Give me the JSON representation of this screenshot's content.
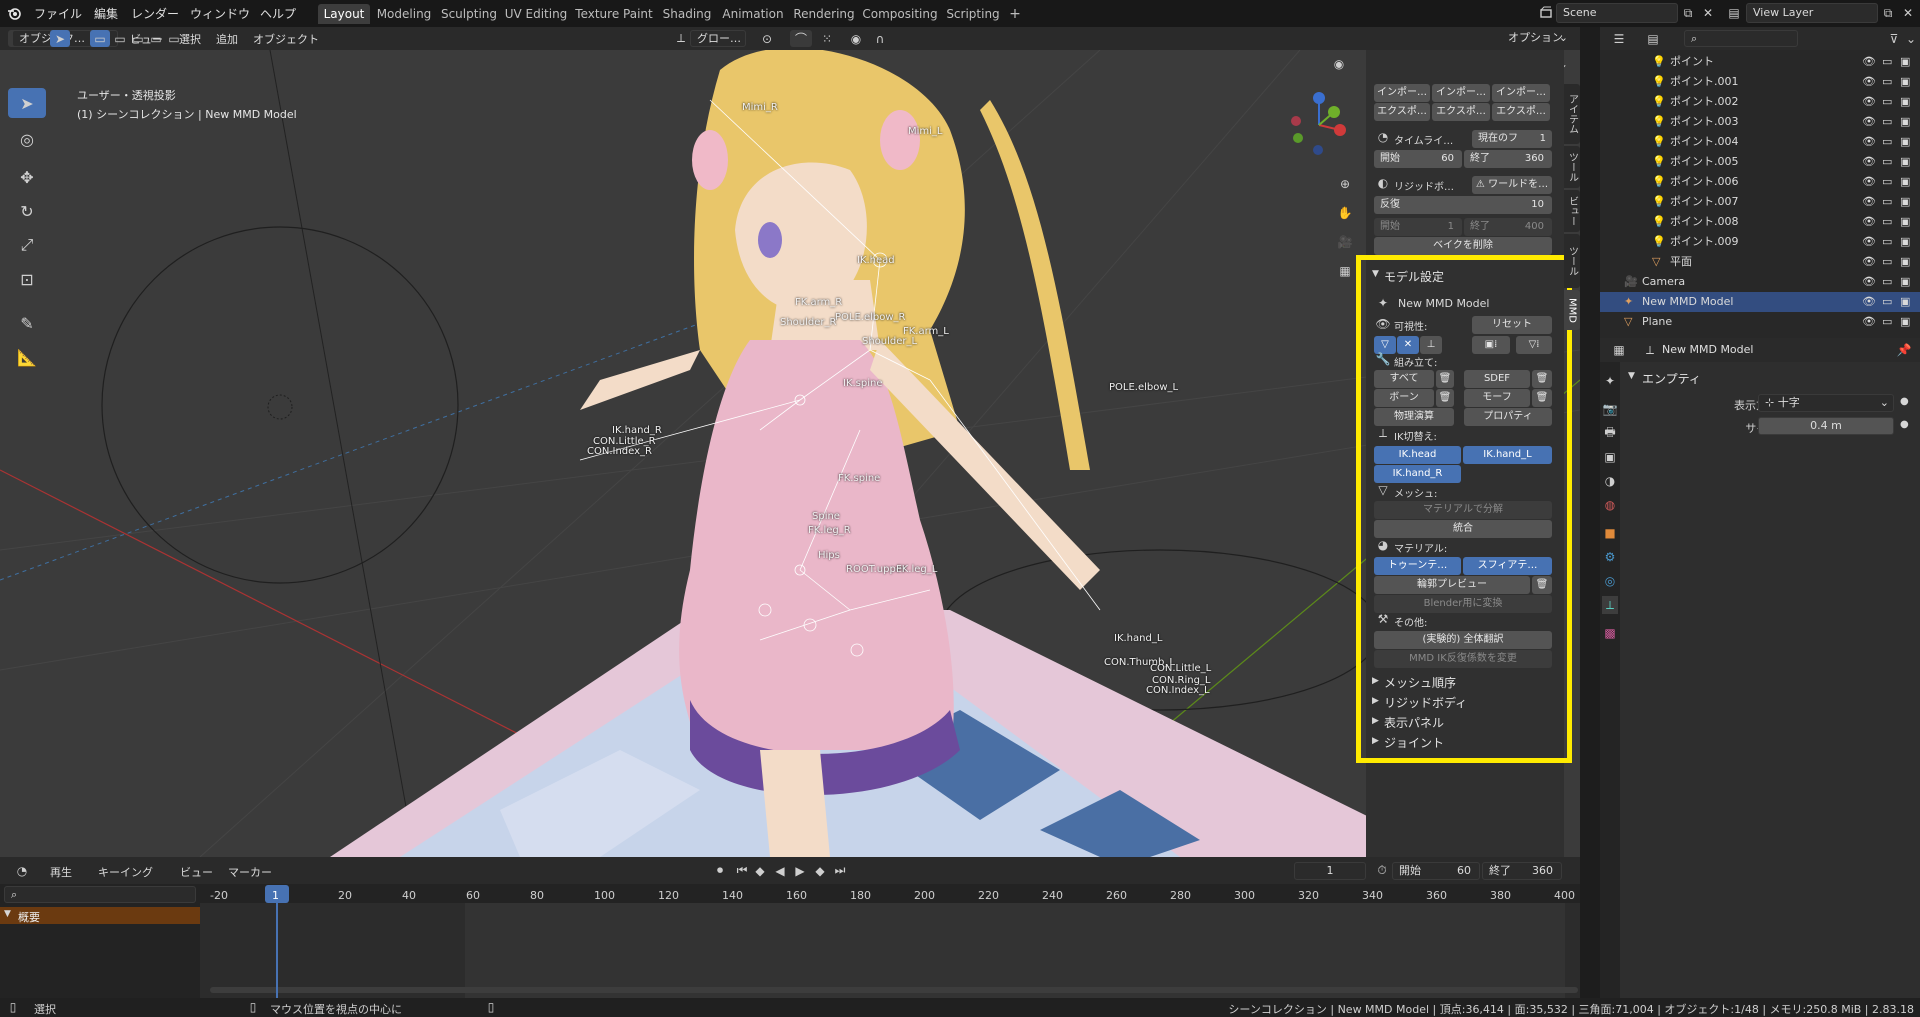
{
  "topbar": {
    "menus": [
      "ファイル",
      "編集",
      "レンダー",
      "ウィンドウ",
      "ヘルプ"
    ],
    "workspaces": [
      "Layout",
      "Modeling",
      "Sculpting",
      "UV Editing",
      "Texture Paint",
      "Shading",
      "Animation",
      "Rendering",
      "Compositing",
      "Scripting"
    ],
    "active_workspace": "Layout",
    "add_workspace_icon": "+",
    "scene_name": "Scene",
    "view_layer": "View Layer",
    "options_label": "オプション"
  },
  "viewport_header": {
    "mode": "オブジェク…",
    "menus": [
      "ビュー",
      "選択",
      "追加",
      "オブジェクト"
    ],
    "transform_orientation": "グロー…"
  },
  "viewport": {
    "view_label": "ユーザー・透視投影",
    "collection_label": "(1) シーンコレクション | New MMD Model",
    "bones": [
      "Mimi_R",
      "Mimi_L",
      "IK.head",
      "FK.arm_R",
      "POLE.elbow_R",
      "FK.arm_L",
      "Shoulder_R",
      "Shoulder_L",
      "IK.spine",
      "POLE.elbow_L",
      "IK.hand_R",
      "CON.Little_R",
      "CON.Index_R",
      "FK.spine",
      "Spine",
      "FK.leg_R",
      "Hips",
      "ROOT.upper",
      "FK.leg_L",
      "IK.hand_L",
      "CON.Thumb_L",
      "CON.Little_L",
      "CON.Ring_L",
      "CON.Index_L"
    ]
  },
  "npanel": {
    "tabs": [
      "アイテム",
      "ツール",
      "ビュー",
      "ツール",
      "MMD"
    ],
    "active_tab": "MMD",
    "top_rows": {
      "import1": "インポー…",
      "import2": "インポー…",
      "import3": "インポー…",
      "export1": "エクスポ…",
      "export2": "エクスポ…",
      "export3": "エクスポ…",
      "timeline_label": "タイムライ…",
      "current_frame_label": "現在のフ",
      "current_frame_value": "1",
      "start_label": "開始",
      "start_value": "60",
      "end_label": "終了",
      "end_value": "360",
      "rigidbody_label": "リジッドボ…",
      "world_label": "ワールドを…",
      "iterations_label": "反復",
      "iterations_value": "10",
      "bake_start_label": "開始",
      "bake_start_value": "1",
      "bake_end_label": "終了",
      "bake_end_value": "400",
      "delete_bake": "ベイクを削除"
    },
    "model_settings": {
      "title": "モデル設定",
      "model_name": "New MMD Model",
      "visibility_label": "可視性:",
      "reset": "リセット",
      "assembly_label": "組み立て:",
      "all": "すべて",
      "sdef": "SDEF",
      "bone": "ボーン",
      "morph": "モーフ",
      "physics": "物理演算",
      "property": "プロパティ",
      "ik_toggle_label": "IK切替え:",
      "ik_buttons": [
        "IK.head",
        "IK.hand_L",
        "IK.hand_R"
      ],
      "mesh_label": "メッシュ:",
      "separate_by_material": "マテリアルで分解",
      "join": "統合",
      "material_label": "マテリアル:",
      "toon": "トゥーンテ…",
      "sphere": "スフィアテ…",
      "edge_preview": "輪郭プレビュー",
      "convert_blender": "Blender用に変換",
      "other_label": "その他:",
      "translate_all": "(実験的) 全体翻訳",
      "change_ik_loop": "MMD IK反復係数を変更"
    },
    "collapsed_panels": [
      "メッシュ順序",
      "リジッドボディ",
      "表示パネル",
      "ジョイント"
    ]
  },
  "outliner": {
    "search_placeholder": "",
    "rows": [
      {
        "name": "ポイント",
        "type": "light"
      },
      {
        "name": "ポイント.001",
        "type": "light"
      },
      {
        "name": "ポイント.002",
        "type": "light"
      },
      {
        "name": "ポイント.003",
        "type": "light"
      },
      {
        "name": "ポイント.004",
        "type": "light"
      },
      {
        "name": "ポイント.005",
        "type": "light"
      },
      {
        "name": "ポイント.006",
        "type": "light"
      },
      {
        "name": "ポイント.007",
        "type": "light"
      },
      {
        "name": "ポイント.008",
        "type": "light"
      },
      {
        "name": "ポイント.009",
        "type": "light"
      },
      {
        "name": "平面",
        "type": "mesh"
      },
      {
        "name": "Camera",
        "type": "camera"
      },
      {
        "name": "New MMD Model",
        "type": "armature"
      },
      {
        "name": "Plane",
        "type": "mesh"
      }
    ],
    "selected": "New MMD Model"
  },
  "properties": {
    "object_name": "New MMD Model",
    "panel_title": "エンプティ",
    "display_label": "表示方法",
    "display_value": "十字",
    "size_label": "サイズ",
    "size_value": "0.4 m"
  },
  "timeline": {
    "menus": [
      "再生",
      "キーイング",
      "ビュー",
      "マーカー"
    ],
    "current_frame": "1",
    "start_label": "開始",
    "start_value": "60",
    "end_label": "終了",
    "end_value": "360",
    "ticks": [
      "-20",
      "1",
      "20",
      "40",
      "60",
      "80",
      "100",
      "120",
      "140",
      "160",
      "180",
      "200",
      "220",
      "240",
      "260",
      "280",
      "300",
      "320",
      "340",
      "360",
      "380",
      "400"
    ],
    "summary_label": "概要"
  },
  "statusbar": {
    "select": "選択",
    "center_view": "マウス位置を視点の中心に",
    "info": "シーンコレクション | New MMD Model | 頂点:36,414 | 面:35,532 | 三角面:71,004 | オブジェクト:1/48 | メモリ:250.8 MiB | 2.83.18"
  },
  "colors": {
    "accent": "#4772b3",
    "highlight_box": "#ffeb00",
    "timeline_summary": "#6b3a10"
  }
}
